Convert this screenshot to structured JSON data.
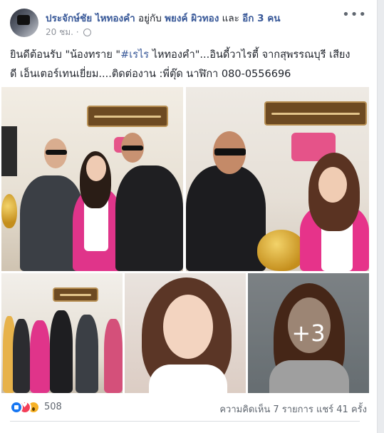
{
  "header": {
    "poster_name": "ประจักษ์ชัย ไหทองคำ",
    "with_text": "อยู่กับ",
    "tagged_name": "พยงค์ ผิวทอง",
    "and_text": "และ",
    "others_text": "อีก 3 คน",
    "time": "20 ชม.",
    "privacy_icon": "globe-icon",
    "more_icon": "ellipsis-icon",
    "more_label": "•••"
  },
  "post": {
    "line1_prefix": "ยินดีต้อนรับ \"น้องทราย \"",
    "hashtag": "#เรไร",
    "line1_suffix": " ไหทองคำ\"...อินดี้วาไรตี้ จากสุพรรณบุรี เสียง",
    "line2": "ดี เอ็นเตอร์เทนเยี่ยม....ติดต่องาน :พี่ตุ๊ด นาฬิกา 080-0556696"
  },
  "photos": {
    "more_count": "+3"
  },
  "footer": {
    "reaction_icons": [
      "like-icon",
      "love-icon",
      "wow-icon"
    ],
    "reaction_count": "508",
    "comments": "ความคิดเห็น 7 รายการ",
    "shares": "แชร์ 41 ครั้ง"
  },
  "colors": {
    "link": "#385898",
    "meta": "#90949c",
    "like": "#1877f2",
    "love": "#f33e58",
    "wow": "#f7b125"
  }
}
